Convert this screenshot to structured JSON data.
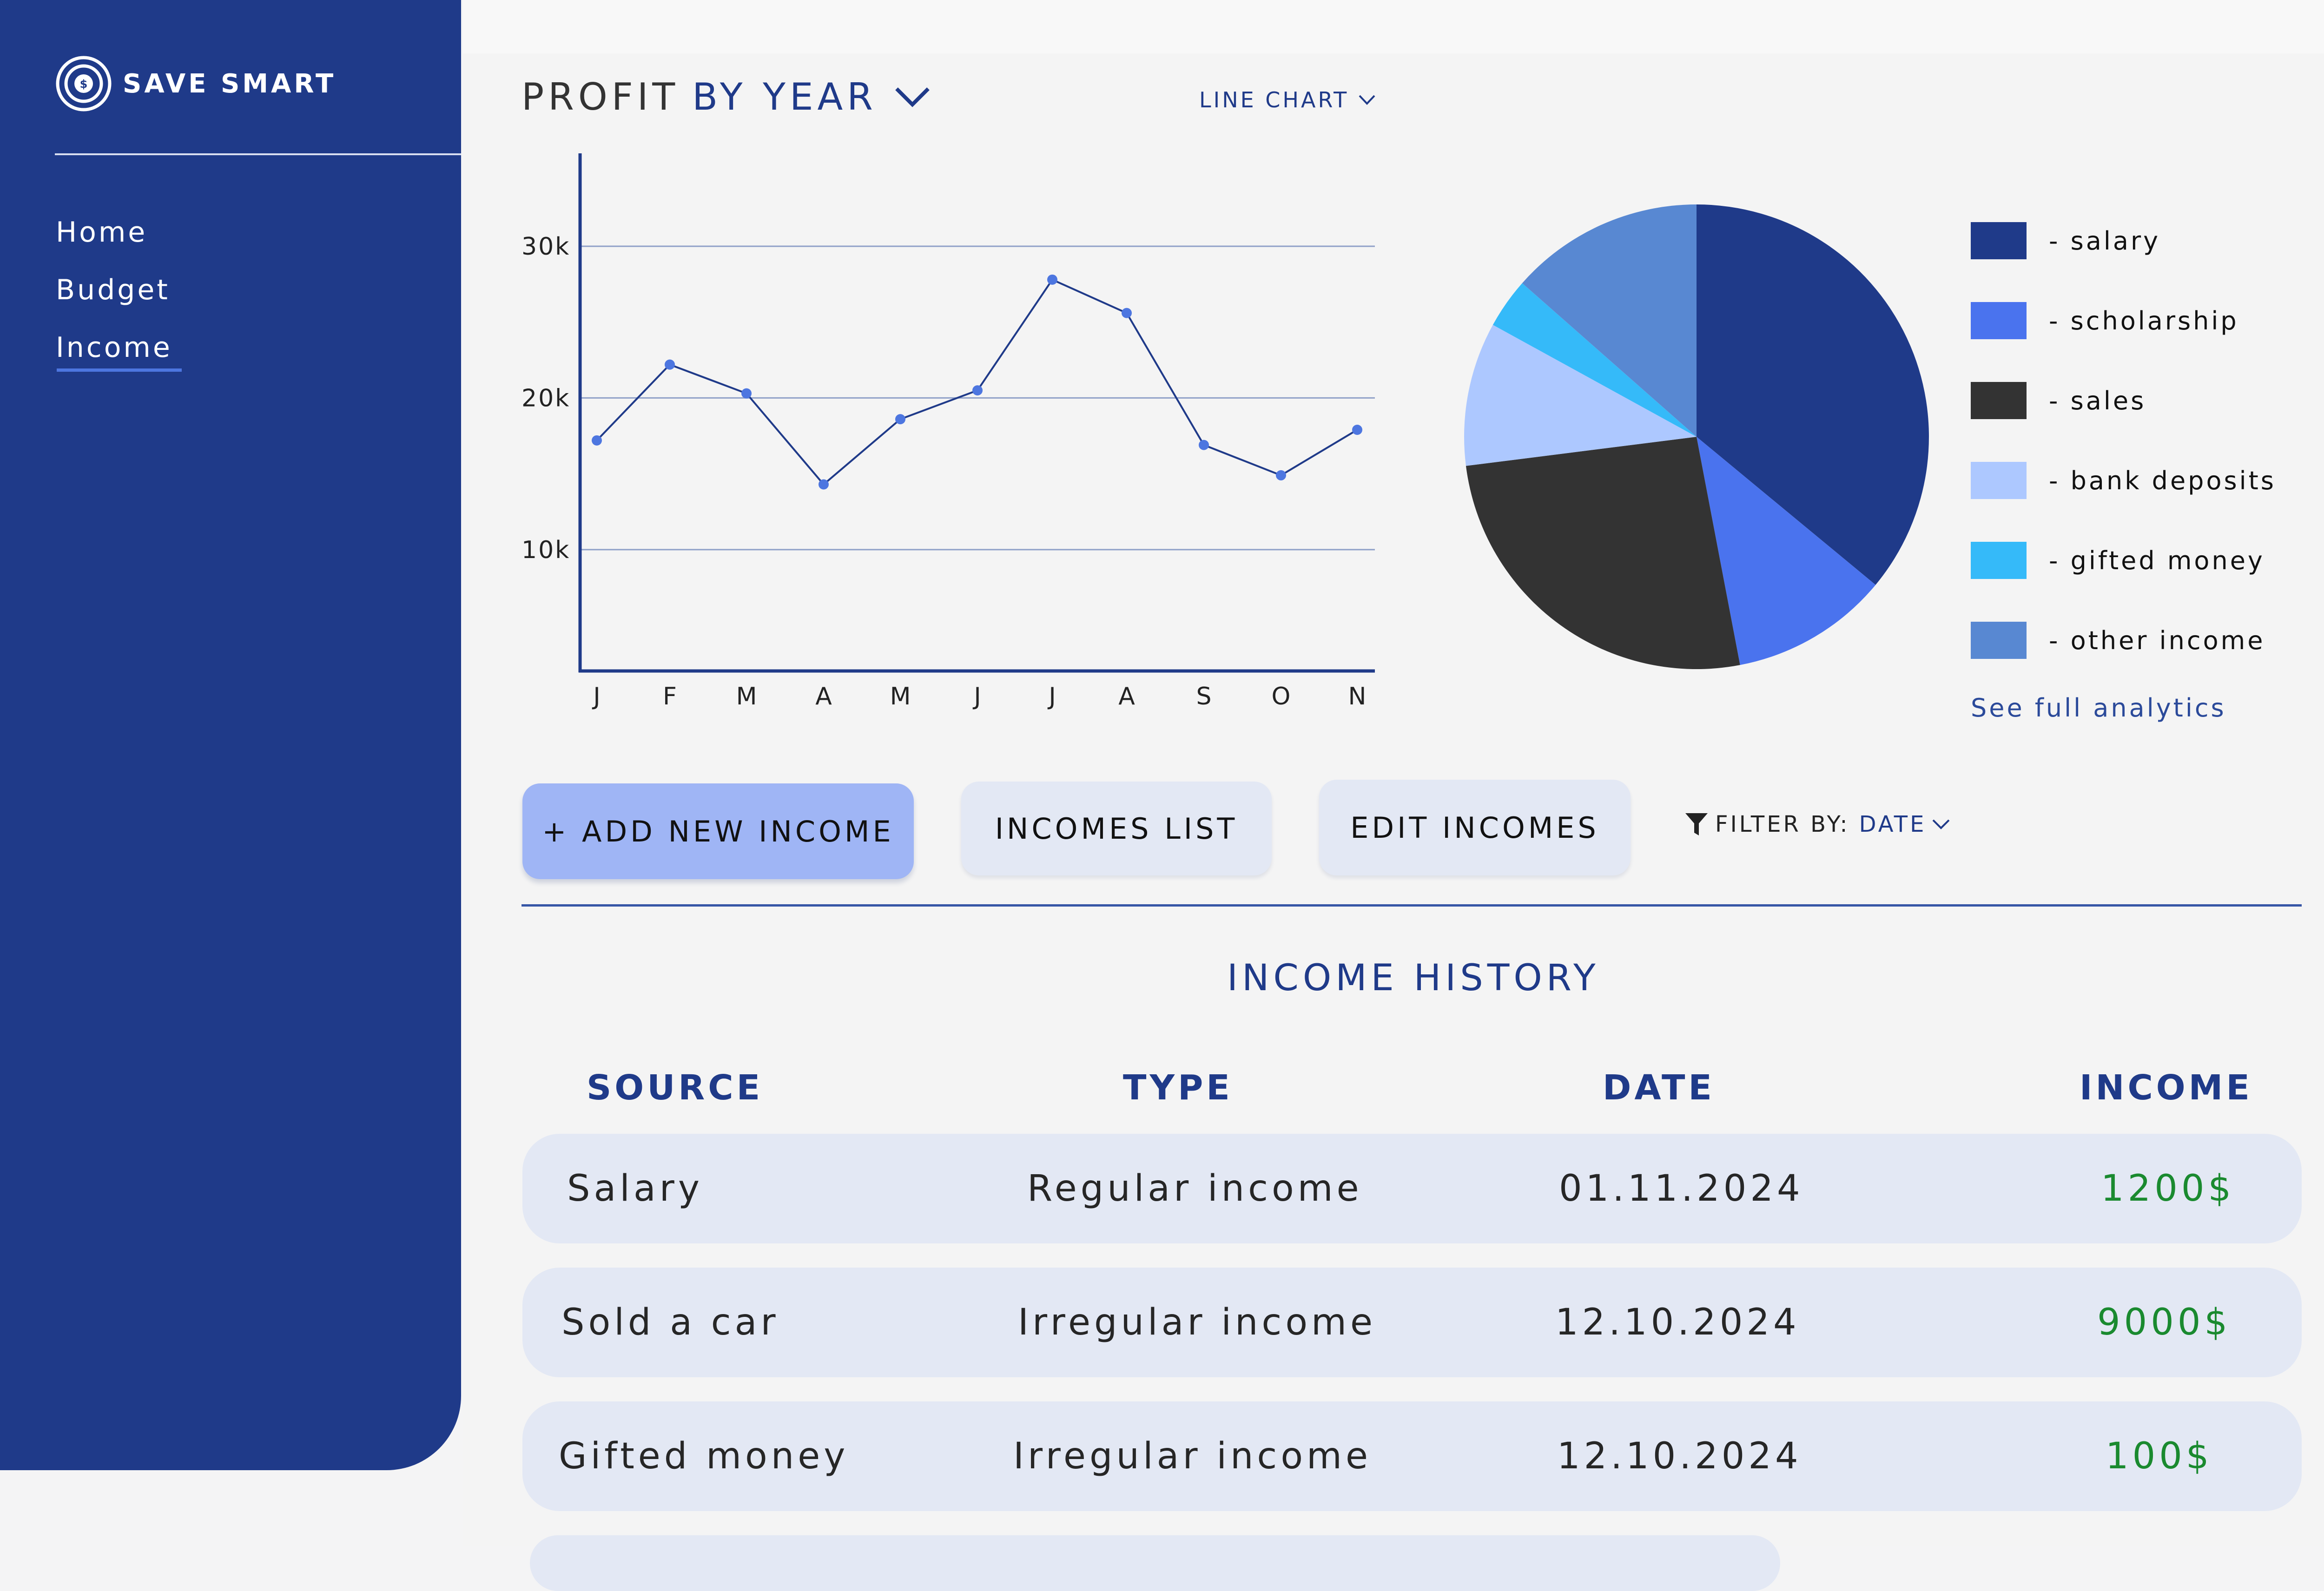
{
  "app": {
    "name": "SAVE SMART"
  },
  "nav": {
    "items": [
      {
        "label": "Home"
      },
      {
        "label": "Budget"
      },
      {
        "label": "Income"
      }
    ],
    "active": "Income"
  },
  "header": {
    "title_part1": "PROFIT",
    "title_part2": "BY YEAR",
    "chart_type_label": "LINE CHART"
  },
  "chart_data": [
    {
      "type": "line",
      "categories": [
        "J",
        "F",
        "M",
        "A",
        "M",
        "J",
        "J",
        "A",
        "S",
        "O",
        "N"
      ],
      "series": [
        {
          "values": [
            17200,
            22200,
            20300,
            14300,
            18600,
            20500,
            27800,
            25600,
            16900,
            14900,
            17900
          ]
        }
      ],
      "yticks": [
        {
          "value": 10000,
          "label": "10k"
        },
        {
          "value": 20000,
          "label": "20k"
        },
        {
          "value": 30000,
          "label": "30k"
        }
      ],
      "ylim": [
        0,
        35000
      ],
      "grid": true,
      "line_color": "#1f3a89",
      "point_color": "#4d76e0"
    },
    {
      "type": "pie",
      "slices": [
        {
          "label": "- salary",
          "value": 36,
          "color": "#1f3a89"
        },
        {
          "label": "- scholarship",
          "value": 11,
          "color": "#4a73ee"
        },
        {
          "label": "- sales",
          "value": 26,
          "color": "#333333"
        },
        {
          "label": "- bank deposits",
          "value": 10,
          "color": "#adc8ff"
        },
        {
          "label": "- gifted money",
          "value": 3.5,
          "color": "#35baf9"
        },
        {
          "label": "- other income",
          "value": 13.5,
          "color": "#5888d2"
        }
      ]
    }
  ],
  "analytics": {
    "link_label": "See full analytics"
  },
  "actions": {
    "add_label": "+ ADD NEW INCOME",
    "list_label": "INCOMES LIST",
    "edit_label": "EDIT INCOMES"
  },
  "filter": {
    "label": "FILTER BY:",
    "value": "DATE"
  },
  "history": {
    "title": "INCOME HISTORY",
    "columns": [
      "SOURCE",
      "TYPE",
      "DATE",
      "INCOME"
    ],
    "rows": [
      {
        "source": "Salary",
        "type": "Regular income",
        "date": "01.11.2024",
        "income": "1200$"
      },
      {
        "source": "Sold a car",
        "type": "Irregular income",
        "date": "12.10.2024",
        "income": "9000$"
      },
      {
        "source": "Gifted money",
        "type": "Irregular income",
        "date": "12.10.2024",
        "income": "100$"
      }
    ]
  },
  "colors": {
    "sidebar": "#1f3a89",
    "accent": "#4d76e0",
    "income_positive": "#1a8a2f",
    "button_primary": "#9fb5f5",
    "button_secondary": "#e3e8f4"
  }
}
